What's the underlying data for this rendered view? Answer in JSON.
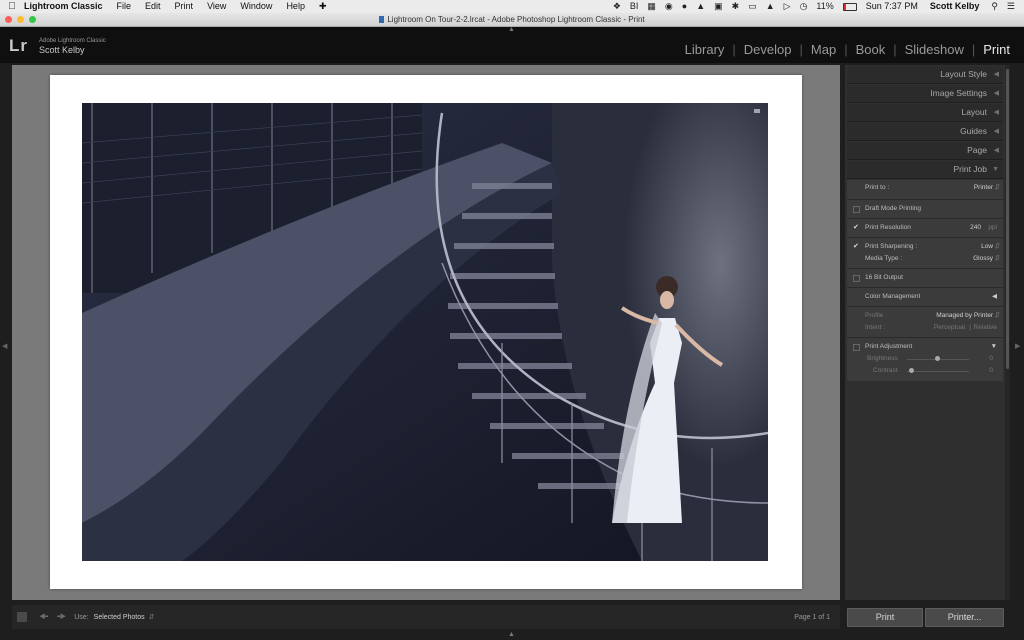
{
  "menubar": {
    "app_name": "Lightroom Classic",
    "menus": [
      "File",
      "Edit",
      "Print",
      "View",
      "Window",
      "Help"
    ],
    "battery": "11%",
    "clock": "Sun 7:37 PM",
    "user": "Scott Kelby"
  },
  "window": {
    "title": "Lightroom On Tour-2-2.lrcat - Adobe Photoshop Lightroom Classic - Print"
  },
  "identity": {
    "logo": "Lr",
    "app_label": "Adobe Lightroom Classic",
    "user_name": "Scott Kelby"
  },
  "modules": {
    "items": [
      "Library",
      "Develop",
      "Map",
      "Book",
      "Slideshow",
      "Print"
    ],
    "active": "Print"
  },
  "panels": {
    "layout_style": "Layout Style",
    "image_settings": "Image Settings",
    "layout": "Layout",
    "guides": "Guides",
    "page": "Page",
    "print_job": "Print Job"
  },
  "print_job": {
    "print_to_label": "Print to :",
    "print_to_value": "Printer",
    "draft_mode": "Draft Mode Printing",
    "resolution_label": "Print Resolution",
    "resolution_value": "240",
    "resolution_unit": "ppi",
    "sharpening_label": "Print Sharpening :",
    "sharpening_value": "Low",
    "media_label": "Media Type :",
    "media_value": "Glossy",
    "bit_output": "16 Bit Output",
    "color_mgmt": "Color Management",
    "profile_label": "Profile :",
    "profile_value": "Managed by Printer",
    "intent_label": "Intent :",
    "intent_perceptual": "Perceptual",
    "intent_relative": "Relative",
    "print_adjustment": "Print Adjustment",
    "brightness_label": "Brightness",
    "contrast_label": "Contrast",
    "brightness_value": "0",
    "contrast_value": "0"
  },
  "toolbar": {
    "use_label": "Use:",
    "use_value": "Selected Photos",
    "page_count": "Page 1 of 1"
  },
  "buttons": {
    "print": "Print",
    "printer": "Printer..."
  }
}
